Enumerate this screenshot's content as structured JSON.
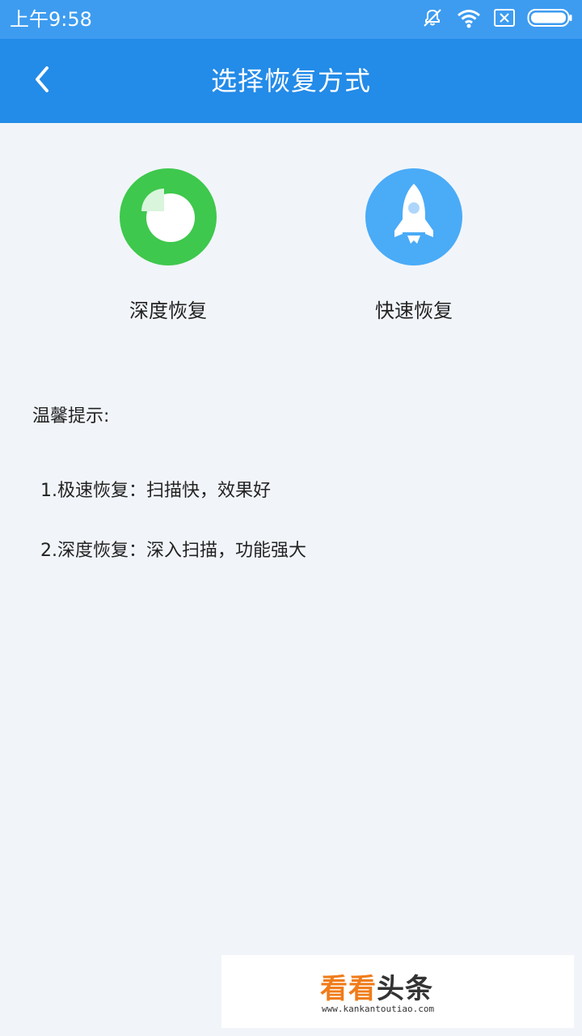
{
  "status_bar": {
    "time": "上午9:58",
    "icons": [
      "mute-icon",
      "wifi-icon",
      "sim-blocked-icon",
      "battery-icon"
    ]
  },
  "header": {
    "title": "选择恢复方式",
    "back_icon": "chevron-left-icon"
  },
  "options": [
    {
      "label": "深度恢复",
      "icon": "pie-chart-icon",
      "color": "#3ec84d"
    },
    {
      "label": "快速恢复",
      "icon": "rocket-icon",
      "color": "#4aabf7"
    }
  ],
  "tips": {
    "title": "温馨提示:",
    "lines": [
      "1.极速恢复：扫描快，效果好",
      "2.深度恢复：深入扫描，功能强大"
    ]
  },
  "watermark": {
    "brand_part1": "看看",
    "brand_part2": "头条",
    "url": "www.kankantoutiao.com"
  },
  "colors": {
    "status_bar": "#3d9cf0",
    "header": "#238be8",
    "background": "#f1f5f9",
    "accent_orange": "#f07c1a"
  }
}
